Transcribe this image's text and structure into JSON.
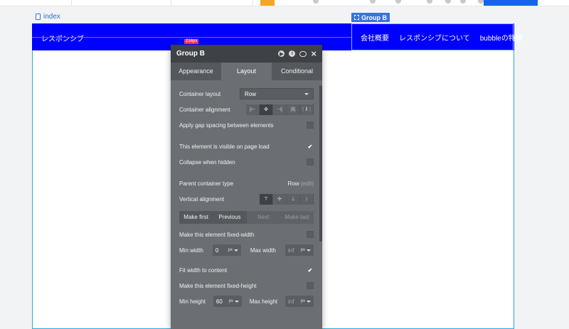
{
  "toolbar": {
    "colors": {
      "accent": "#f5a623",
      "blue": "#1565e8"
    }
  },
  "page_link": "index",
  "group_tag": "Group B",
  "header": {
    "brand": "レスポンシブ",
    "nav": [
      "会社概要",
      "レスポンシブについて",
      "bubbleの特徴"
    ],
    "bg_color": "#0000ff",
    "spacing_badge": "216px"
  },
  "panel": {
    "title": "Group B",
    "tabs": [
      "Appearance",
      "Layout",
      "Conditional"
    ],
    "active_tab": "Layout",
    "container_layout": {
      "label": "Container layout",
      "value": "Row"
    },
    "container_alignment": {
      "label": "Container alignment"
    },
    "gap_spacing": {
      "label": "Apply gap spacing between elements",
      "checked": false
    },
    "visible_on_load": {
      "label": "This element is visible on page load",
      "checked": true
    },
    "collapse_hidden": {
      "label": "Collapse when hidden",
      "checked": false
    },
    "parent_type": {
      "label": "Parent container type",
      "value": "Row",
      "edit": "(edit)"
    },
    "vertical_alignment": {
      "label": "Vertical alignment"
    },
    "order_buttons": [
      "Make first",
      "Previous",
      "Next",
      "Make last"
    ],
    "fixed_width": {
      "label": "Make this element fixed-width",
      "checked": false
    },
    "min_width": {
      "label": "Min width",
      "value": "0",
      "unit": "px"
    },
    "max_width": {
      "label": "Max width",
      "value": "inf",
      "unit": "px"
    },
    "fit_width": {
      "label": "Fit width to content",
      "checked": true
    },
    "fixed_height": {
      "label": "Make this element fixed-height",
      "checked": false
    },
    "min_height": {
      "label": "Min height",
      "value": "60",
      "unit": "px"
    },
    "max_height": {
      "label": "Max height",
      "value": "inf",
      "unit": "px"
    }
  }
}
